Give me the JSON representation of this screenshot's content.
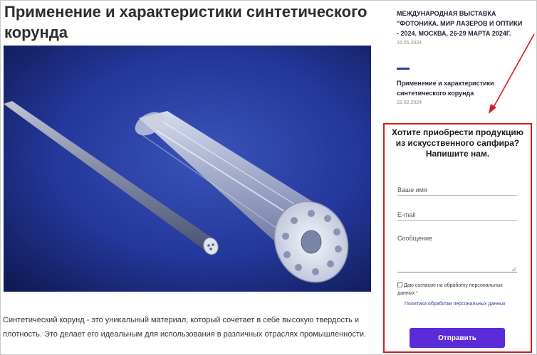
{
  "article": {
    "title": "Применение и характеристики синтетического корунда",
    "intro": "Синтетический корунд - это уникальный материал, который сочетает в себе высокую твердость и плотность. Это делает его идеальным для использования в различных отраслях промышленности."
  },
  "sidebar": {
    "news": [
      {
        "title": "МЕЖДУНАРОДНАЯ ВЫСТАВКА \"ФОТОНИКА. МИР ЛАЗЕРОВ И ОПТИКИ - 2024. МОСКВА, 26-29 МАРТА 2024г.",
        "date": "15.05.2024"
      },
      {
        "title": "Применение и характеристики синтетического корунда",
        "date": "22.02.2024"
      }
    ]
  },
  "contact_form": {
    "heading": "Хотите приобрести продукцию из искусственного сапфира? Напишите нам.",
    "name_placeholder": "Ваше имя",
    "email_placeholder": "E-mail",
    "message_placeholder": "Сообщение",
    "consent_text": "Даю согласие на обработку персональных данных",
    "required_mark": "*",
    "policy_link": "Политика обработки персональных данных",
    "submit_label": "Отправить"
  },
  "colors": {
    "accent": "#5a2bd6",
    "highlight_border": "#d11d1d",
    "link": "#2b3fa3",
    "divider": "#2a3d9a",
    "image_background": "#1e2c6e"
  },
  "icons": {
    "annotation": "red-arrow-icon",
    "textarea_resize": "resize-grip-icon",
    "checkbox": "checkbox-icon"
  }
}
